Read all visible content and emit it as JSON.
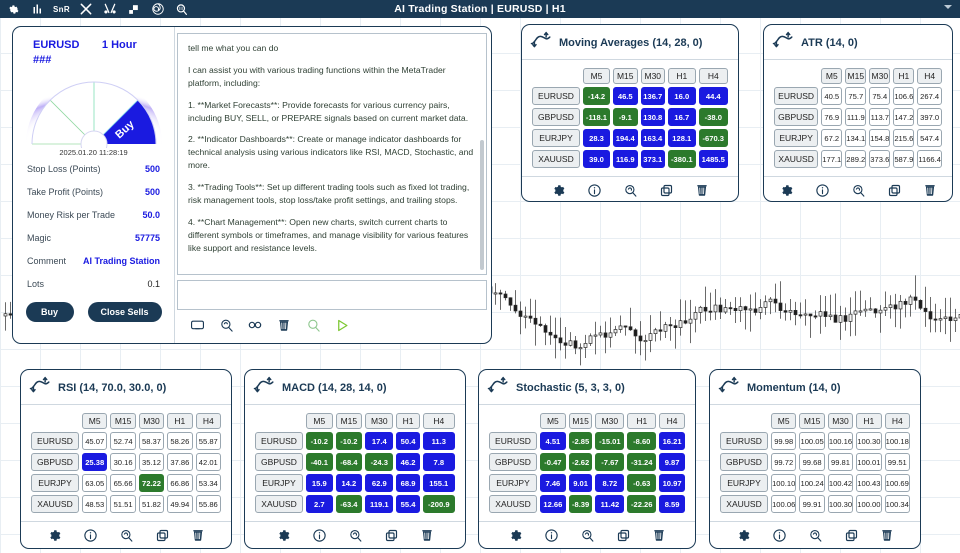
{
  "topbar": {
    "title": "AI Trading Station  |  EURUSD  |  H1",
    "tools": [
      {
        "name": "gear-icon",
        "label": ""
      },
      {
        "name": "bars-icon",
        "label": ""
      },
      {
        "name": "snr-icon",
        "label": "SnR"
      },
      {
        "name": "crosshair-icon",
        "label": ""
      },
      {
        "name": "fractal-icon",
        "label": ""
      },
      {
        "name": "squares-icon",
        "label": ""
      },
      {
        "name": "spiral-icon",
        "label": ""
      },
      {
        "name": "magnifier-icon",
        "label": ""
      }
    ]
  },
  "station": {
    "symbol": "EURUSD",
    "timeframe": "1 Hour",
    "price": "###",
    "gauge": {
      "signal": "Buy",
      "timestamp": "2025.01.20 11:28:19",
      "segments": [
        "",
        "",
        "",
        "",
        "Buy"
      ],
      "active_index": 4,
      "active_color": "#1a1ae0"
    },
    "params": [
      {
        "label": "Stop Loss (Points)",
        "value": "500",
        "accent": true
      },
      {
        "label": "Take Profit (Points)",
        "value": "500",
        "accent": true
      },
      {
        "label": "Money Risk per Trade",
        "value": "50.0",
        "accent": true
      },
      {
        "label": "Magic",
        "value": "57775",
        "accent": true
      },
      {
        "label": "Comment",
        "value": "AI Trading Station",
        "accent": true
      },
      {
        "label": "Lots",
        "value": "0.1",
        "accent": false
      }
    ],
    "buttons": {
      "buy": "Buy",
      "close_sells": "Close Sells"
    }
  },
  "chat": {
    "messages": [
      "tell me what you can do",
      "I can assist you with various trading functions within the MetaTrader platform, including:",
      "1. **Market Forecasts**: Provide forecasts for various currency pairs, including BUY, SELL, or PREPARE signals based on current market data.",
      "2. **Indicator Dashboards**: Create or manage indicator dashboards for technical analysis using various indicators like RSI, MACD, Stochastic, and more.",
      "3. **Trading Tools**: Set up different trading tools such as fixed lot trading, risk management tools, stop loss/take profit settings, and trailing stops.",
      "4. **Chart Management**: Open new charts, switch current charts to different symbols or timeframes, and manage visibility for various features like support and resistance levels."
    ],
    "input_value": "",
    "input_placeholder": "",
    "tools": [
      {
        "name": "monitor-icon"
      },
      {
        "name": "magnifier-refresh-icon"
      },
      {
        "name": "infinity-icon"
      },
      {
        "name": "trash-icon"
      },
      {
        "name": "magnifier-green-icon"
      },
      {
        "name": "send-play-icon"
      }
    ]
  },
  "footer_icons": [
    {
      "name": "gear-icon"
    },
    {
      "name": "info-icon"
    },
    {
      "name": "magnifier-refresh-icon"
    },
    {
      "name": "duplicate-icon"
    },
    {
      "name": "trash-icon"
    }
  ],
  "colors": {
    "blue": "#1a1ae0",
    "green": "#2c7a2c",
    "navy": "#1b3a55"
  },
  "chart_data": {
    "type": "table",
    "title": "Indicator Dashboards",
    "columns": [
      "M5",
      "M15",
      "M30",
      "H1",
      "H4"
    ],
    "rows": [
      "EURUSD",
      "GBPUSD",
      "EURJPY",
      "XAUUSD"
    ],
    "panels": [
      {
        "id": "ma",
        "title": "Moving Averages (14, 28, 0)",
        "values": [
          [
            "-14.2",
            "46.5",
            "136.7",
            "16.0",
            "44.4"
          ],
          [
            "-118.1",
            "-9.1",
            "130.8",
            "16.7",
            "-38.0"
          ],
          [
            "28.3",
            "194.4",
            "163.4",
            "128.1",
            "-670.3"
          ],
          [
            "39.0",
            "116.9",
            "373.1",
            "-380.1",
            "1485.5"
          ]
        ],
        "styles": [
          [
            "green",
            "blue",
            "blue",
            "blue",
            "blue"
          ],
          [
            "green",
            "green",
            "blue",
            "blue",
            "green"
          ],
          [
            "blue",
            "blue",
            "blue",
            "blue",
            "green"
          ],
          [
            "blue",
            "blue",
            "blue",
            "green",
            "blue"
          ]
        ]
      },
      {
        "id": "atr",
        "title": "ATR (14, 0)",
        "values": [
          [
            "40.5",
            "75.7",
            "75.4",
            "106.6",
            "267.4"
          ],
          [
            "76.9",
            "111.9",
            "113.7",
            "147.2",
            "397.0"
          ],
          [
            "67.2",
            "134.1",
            "154.8",
            "215.6",
            "547.4"
          ],
          [
            "177.1",
            "289.2",
            "373.6",
            "587.9",
            "1166.4"
          ]
        ],
        "styles": [
          [
            "",
            "",
            "",
            "",
            ""
          ],
          [
            "",
            "",
            "",
            "",
            ""
          ],
          [
            "",
            "",
            "",
            "",
            ""
          ],
          [
            "",
            "",
            "",
            "",
            ""
          ]
        ]
      },
      {
        "id": "rsi",
        "title": "RSI (14, 70.0, 30.0, 0)",
        "values": [
          [
            "45.07",
            "52.74",
            "58.37",
            "58.26",
            "55.87"
          ],
          [
            "25.38",
            "30.16",
            "35.12",
            "37.86",
            "42.01"
          ],
          [
            "63.05",
            "65.66",
            "72.22",
            "66.86",
            "53.34"
          ],
          [
            "48.53",
            "51.51",
            "51.82",
            "49.94",
            "55.86"
          ]
        ],
        "styles": [
          [
            "",
            "",
            "",
            "",
            ""
          ],
          [
            "blue",
            "",
            "",
            "",
            ""
          ],
          [
            "",
            "",
            "green",
            "",
            ""
          ],
          [
            "",
            "",
            "",
            "",
            ""
          ]
        ]
      },
      {
        "id": "macd",
        "title": "MACD (14, 28, 14, 0)",
        "values": [
          [
            "-10.2",
            "-10.2",
            "17.4",
            "50.4",
            "11.3"
          ],
          [
            "-40.1",
            "-68.4",
            "-24.3",
            "46.2",
            "7.8"
          ],
          [
            "15.9",
            "14.2",
            "62.9",
            "68.9",
            "155.1"
          ],
          [
            "2.7",
            "-63.4",
            "119.1",
            "55.4",
            "-200.9"
          ]
        ],
        "styles": [
          [
            "green",
            "green",
            "blue",
            "blue",
            "blue"
          ],
          [
            "green",
            "green",
            "green",
            "blue",
            "blue"
          ],
          [
            "blue",
            "blue",
            "blue",
            "blue",
            "blue"
          ],
          [
            "blue",
            "green",
            "blue",
            "blue",
            "green"
          ]
        ]
      },
      {
        "id": "stoch",
        "title": "Stochastic (5, 3, 3, 0)",
        "values": [
          [
            "4.51",
            "-2.85",
            "-15.01",
            "-8.60",
            "16.21"
          ],
          [
            "-0.47",
            "-2.62",
            "-7.67",
            "-31.24",
            "9.87"
          ],
          [
            "7.46",
            "9.01",
            "8.72",
            "-0.63",
            "10.97"
          ],
          [
            "12.66",
            "-8.39",
            "11.42",
            "-22.26",
            "8.59"
          ]
        ],
        "styles": [
          [
            "blue",
            "green",
            "green",
            "green",
            "blue"
          ],
          [
            "green",
            "green",
            "green",
            "green",
            "blue"
          ],
          [
            "blue",
            "blue",
            "blue",
            "green",
            "blue"
          ],
          [
            "blue",
            "green",
            "blue",
            "green",
            "blue"
          ]
        ]
      },
      {
        "id": "mom",
        "title": "Momentum (14, 0)",
        "values": [
          [
            "99.98",
            "100.05",
            "100.16",
            "100.30",
            "100.18"
          ],
          [
            "99.72",
            "99.68",
            "99.81",
            "100.01",
            "99.51"
          ],
          [
            "100.10",
            "100.24",
            "100.42",
            "100.43",
            "100.69"
          ],
          [
            "100.06",
            "99.91",
            "100.30",
            "100.00",
            "100.34"
          ]
        ],
        "styles": [
          [
            "",
            "",
            "",
            "",
            ""
          ],
          [
            "",
            "",
            "",
            "",
            ""
          ],
          [
            "",
            "",
            "",
            "",
            ""
          ],
          [
            "",
            "",
            "",
            "",
            ""
          ]
        ]
      }
    ]
  }
}
